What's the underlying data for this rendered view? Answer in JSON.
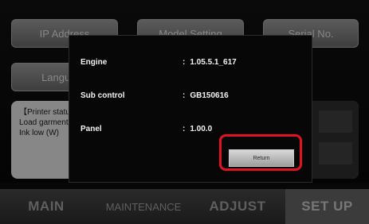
{
  "background": {
    "buttons": {
      "ip": "IP Address",
      "middle": "Model Setting",
      "serial": "Serial No.",
      "language": "Language"
    },
    "message_lines": [
      "【Printer status】",
      "Load garment",
      "Ink low (W)"
    ]
  },
  "dialog": {
    "rows": [
      {
        "label": "Engine",
        "value": "1.05.5.1_617"
      },
      {
        "label": "Sub control",
        "value": "GB150616"
      },
      {
        "label": "Panel",
        "value": "1.00.0"
      }
    ],
    "colon": ":",
    "return_label": "Return",
    "highlight_color": "#e0141e"
  },
  "tabs": [
    {
      "label": "MAIN"
    },
    {
      "label": "MAINTENANCE"
    },
    {
      "label": "ADJUST"
    },
    {
      "label": "SET UP",
      "active": true
    }
  ]
}
